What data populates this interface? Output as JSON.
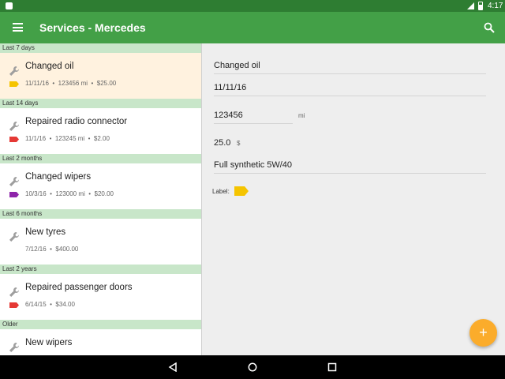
{
  "status_bar": {
    "time": "4:17",
    "icons": [
      "android-icon",
      "signal-icon",
      "battery-icon"
    ]
  },
  "app_bar": {
    "title": "Services - Mercedes",
    "menu_icon": "menu-icon",
    "search_icon": "search-icon"
  },
  "colors": {
    "primary": "#43a047",
    "primary_dark": "#2e7d32",
    "section": "#c8e6c9",
    "selected": "#fff2df",
    "accent": "#fbac2b",
    "label_yellow": "#f5c400",
    "label_red": "#e53935",
    "label_purple": "#8e24aa"
  },
  "list": {
    "sections": [
      {
        "header": "Last 7 days",
        "item": {
          "title": "Changed oil",
          "date": "11/11/16",
          "mileage": "123456 mi",
          "cost": "$25.00",
          "label_color": "yellow",
          "selected": true
        }
      },
      {
        "header": "Last 14 days",
        "item": {
          "title": "Repaired radio connector",
          "date": "11/1/16",
          "mileage": "123245 mi",
          "cost": "$2.00",
          "label_color": "red"
        }
      },
      {
        "header": "Last 2 months",
        "item": {
          "title": "Changed wipers",
          "date": "10/3/16",
          "mileage": "123000 mi",
          "cost": "$20.00",
          "label_color": "purple"
        }
      },
      {
        "header": "Last 6 months",
        "item": {
          "title": "New tyres",
          "date": "7/12/16",
          "mileage": "",
          "cost": "$400.00",
          "label_color": ""
        }
      },
      {
        "header": "Last 2 years",
        "item": {
          "title": "Repaired passenger doors",
          "date": "6/14/15",
          "mileage": "",
          "cost": "$34.00",
          "label_color": "red"
        }
      },
      {
        "header": "Older",
        "item": {
          "title": "New wipers",
          "date": "",
          "mileage": "",
          "cost": "",
          "label_color": ""
        }
      }
    ],
    "separator": "•"
  },
  "detail": {
    "title": "Changed oil",
    "date": "11/11/16",
    "mileage": "123456",
    "mileage_unit": "mi",
    "cost": "25.0",
    "cost_unit": "$",
    "note": "Full synthetic 5W/40",
    "label_caption": "Label:",
    "label_color": "yellow"
  },
  "fab": {
    "symbol": "+"
  },
  "nav_bar": {
    "buttons": [
      "back-icon",
      "home-icon",
      "recents-icon"
    ]
  }
}
